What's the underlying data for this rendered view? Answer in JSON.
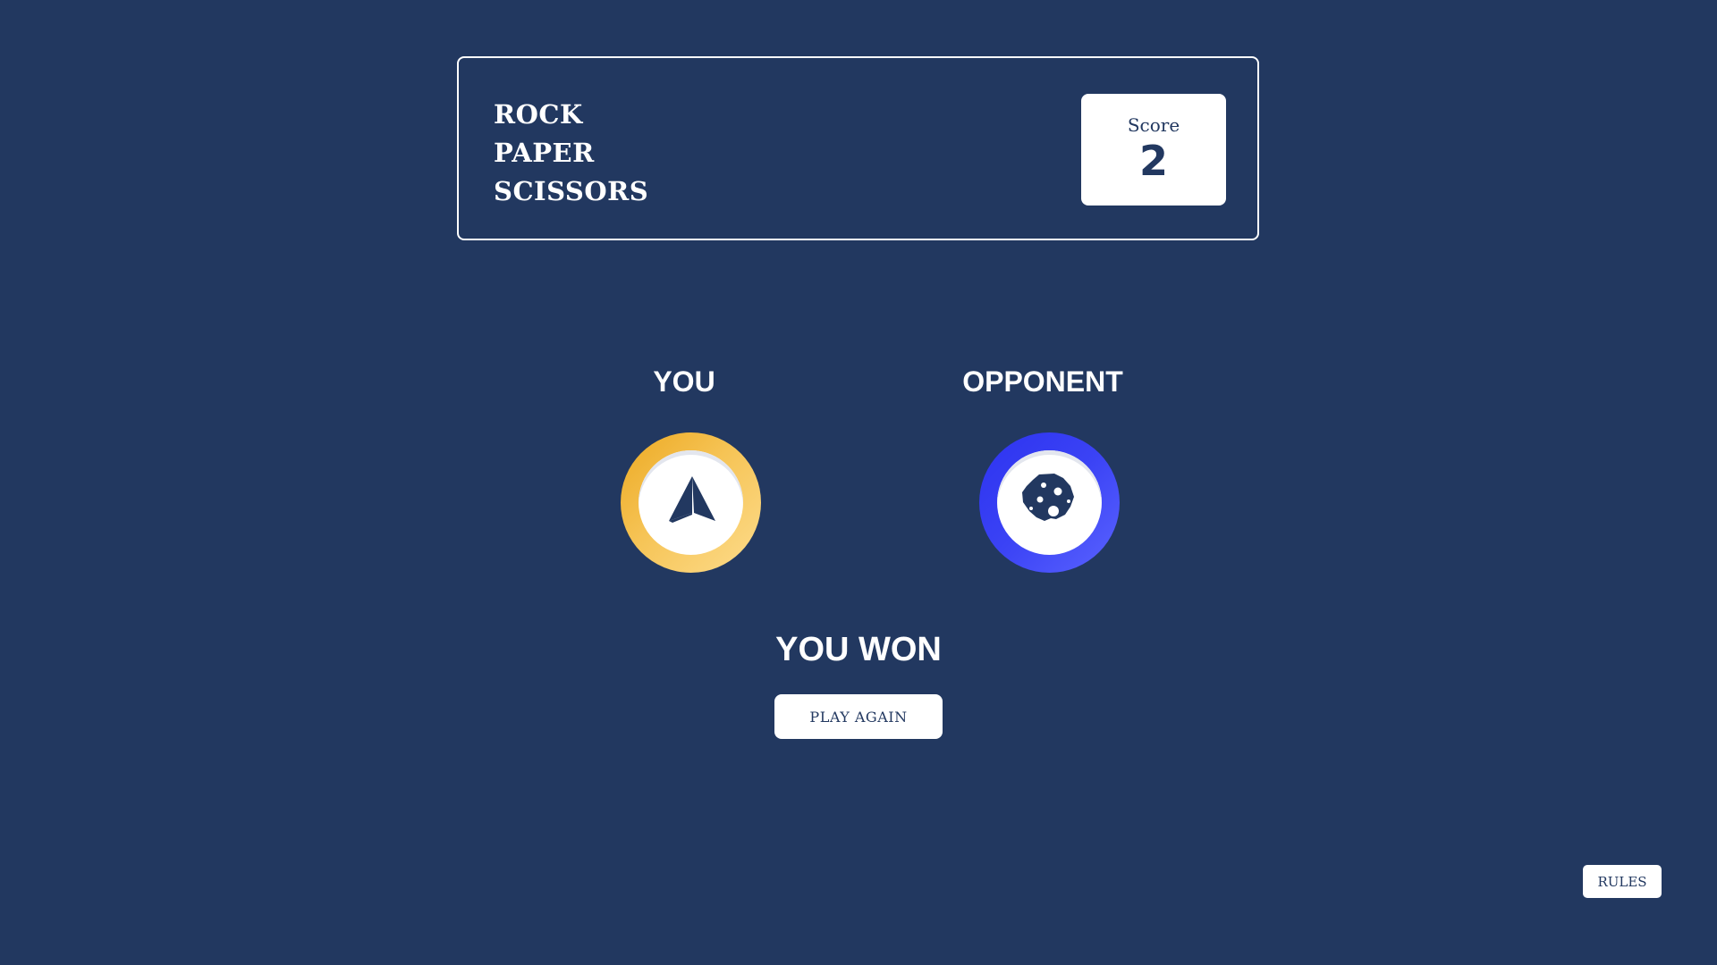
{
  "header": {
    "title_lines": [
      "ROCK",
      "PAPER",
      "SCISSORS"
    ],
    "score_label": "Score",
    "score_value": "2"
  },
  "players": {
    "you": {
      "label": "YOU",
      "icon": "paper-plane-icon",
      "ring_color": "#f6c456"
    },
    "opponent": {
      "label": "OPPONENT",
      "icon": "rock-icon",
      "ring_color": "#3b43f5"
    }
  },
  "result": {
    "text": "YOU WON",
    "play_again_label": "PLAY AGAIN"
  },
  "rules_label": "RULES",
  "colors": {
    "background": "#223860",
    "text_dark": "#223860",
    "white": "#ffffff"
  }
}
